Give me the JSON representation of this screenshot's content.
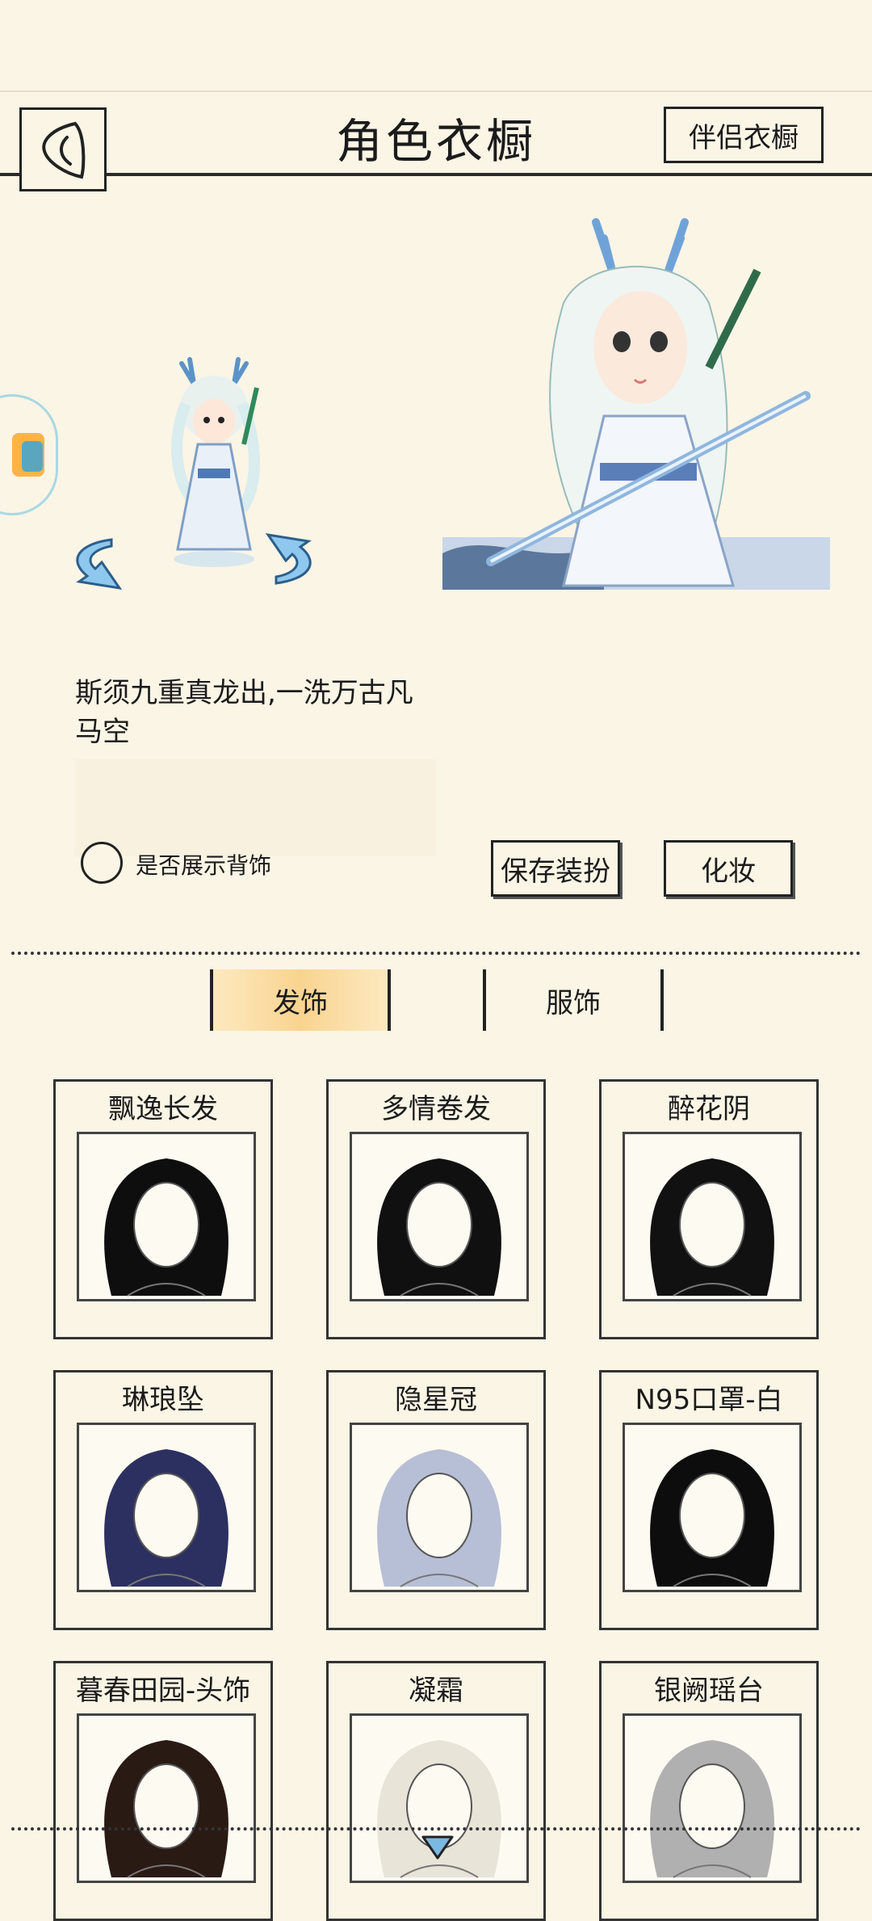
{
  "header": {
    "title": "角色衣橱",
    "partner_wardrobe_label": "伴侣衣橱"
  },
  "character": {
    "description": "斯须九重真龙出,一洗万古凡马空"
  },
  "options": {
    "show_back_accessory_label": "是否展示背饰",
    "save_outfit_label": "保存装扮",
    "makeup_label": "化妆"
  },
  "tabs": [
    {
      "label": "发饰",
      "active": true
    },
    {
      "label": "服饰",
      "active": false
    }
  ],
  "items": [
    {
      "name": "飘逸长发",
      "hair": "#0e0e0e"
    },
    {
      "name": "多情卷发",
      "hair": "#101010"
    },
    {
      "name": "醉花阴",
      "hair": "#111111"
    },
    {
      "name": "琳琅坠",
      "hair": "#2c3060"
    },
    {
      "name": "隐星冠",
      "hair": "#b7bfd6"
    },
    {
      "name": "N95口罩-白",
      "hair": "#0d0d0d"
    },
    {
      "name": "暮春田园-头饰",
      "hair": "#2a1a14"
    },
    {
      "name": "凝霜",
      "hair": "#e8e4d8"
    },
    {
      "name": "银阙瑶台",
      "hair": "#b0b0b0"
    }
  ],
  "colors": {
    "background": "#fbf5e6",
    "ink": "#1b1b1b",
    "tab_highlight": "#f9d490",
    "accent_blue": "#4f8fc8"
  }
}
